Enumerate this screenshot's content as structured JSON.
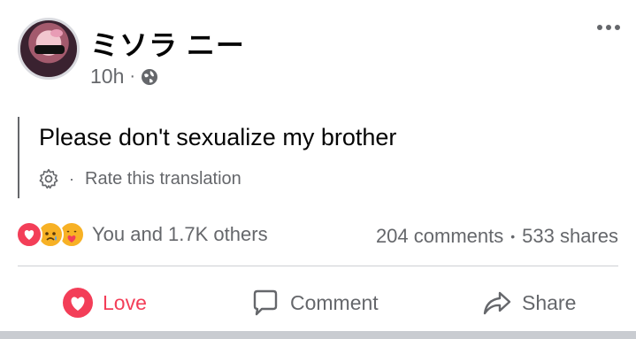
{
  "post": {
    "author": "ミソラ ニー",
    "time": "10h",
    "meta_separator": "·",
    "audience_icon": "globe-icon",
    "more_icon": "more-options-icon"
  },
  "translation": {
    "text": "Please don't sexualize my brother",
    "rate_separator": "·",
    "rate_label": "Rate this translation",
    "settings_icon": "gear-icon"
  },
  "reactions": {
    "icons": [
      "love-reaction-icon",
      "sad-reaction-icon",
      "care-reaction-icon"
    ],
    "summary": "You and 1.7K others",
    "comments": "204 comments",
    "stats_separator": "•",
    "shares": "533 shares"
  },
  "actions": {
    "love_label": "Love",
    "comment_label": "Comment",
    "share_label": "Share"
  },
  "colors": {
    "love": "#f33e58",
    "secondary_text": "#65676b",
    "primary_text": "#050505",
    "divider": "#ced0d4"
  }
}
